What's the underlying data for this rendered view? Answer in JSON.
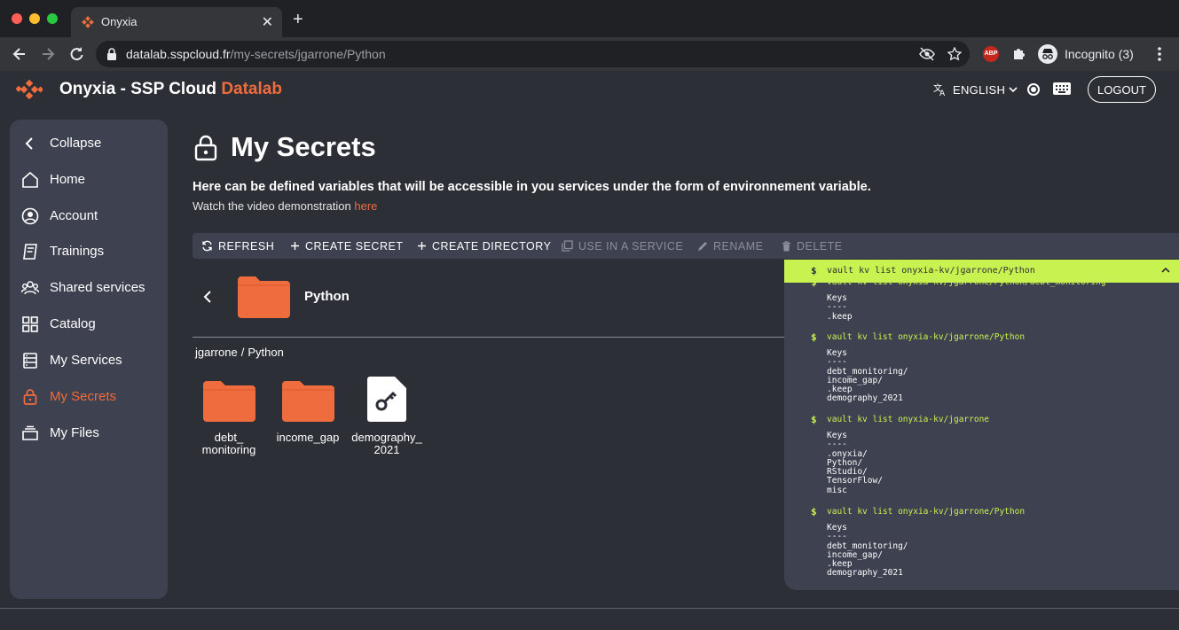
{
  "browser": {
    "tab_title": "Onyxia",
    "url_host": "datalab.sspcloud.fr",
    "url_path": "/my-secrets/jgarrone/Python",
    "profile_label": "Incognito (3)",
    "abp_label": "ABP"
  },
  "header": {
    "title": "Onyxia - SSP Cloud",
    "title_accent": "Datalab",
    "language": "ENGLISH",
    "logout": "LOGOUT"
  },
  "sidebar": {
    "items": [
      {
        "label": "Collapse",
        "icon": "chevron-left-icon"
      },
      {
        "label": "Home",
        "icon": "home-icon"
      },
      {
        "label": "Account",
        "icon": "account-icon"
      },
      {
        "label": "Trainings",
        "icon": "trainings-icon"
      },
      {
        "label": "Shared services",
        "icon": "shared-services-icon"
      },
      {
        "label": "Catalog",
        "icon": "catalog-icon"
      },
      {
        "label": "My Services",
        "icon": "services-icon"
      },
      {
        "label": "My Secrets",
        "icon": "lock-icon",
        "active": true
      },
      {
        "label": "My Files",
        "icon": "files-icon"
      }
    ]
  },
  "page": {
    "title": "My Secrets",
    "subtitle": "Here can be defined variables that will be accessible in you services under the form of environnement variable.",
    "help_prefix": "Watch the video demonstration",
    "help_link": "here"
  },
  "actions": [
    {
      "label": "REFRESH",
      "enabled": true
    },
    {
      "label": "CREATE SECRET",
      "enabled": true
    },
    {
      "label": "CREATE DIRECTORY",
      "enabled": true
    },
    {
      "label": "USE IN A SERVICE",
      "enabled": false
    },
    {
      "label": "RENAME",
      "enabled": false
    },
    {
      "label": "DELETE",
      "enabled": false
    }
  ],
  "directory": {
    "current": "Python",
    "breadcrumb": [
      "jgarrone",
      "Python"
    ],
    "items": [
      {
        "type": "folder",
        "name": "debt_\nmonitoring"
      },
      {
        "type": "folder",
        "name": "income_gap"
      },
      {
        "type": "secret",
        "name": "demography_\n2021"
      }
    ]
  },
  "terminal": {
    "head_command": "vault kv list onyxia-kv/jgarrone/Python",
    "partial_command": "vault kv list onyxia-kv/jgarrone/Python/debt_monitoring",
    "partial_output": "Keys\n----\n.keep",
    "blocks": [
      {
        "command": "vault kv list onyxia-kv/jgarrone/Python",
        "output": "Keys\n----\ndebt_monitoring/\nincome_gap/\n.keep\ndemography_2021"
      },
      {
        "command": "vault kv list onyxia-kv/jgarrone",
        "output": "Keys\n----\n.onyxia/\nPython/\nRStudio/\nTensorFlow/\nmisc"
      },
      {
        "command": "vault kv list onyxia-kv/jgarrone/Python",
        "output": "Keys\n----\ndebt_monitoring/\nincome_gap/\n.keep\ndemography_2021"
      }
    ],
    "prompt": "$"
  },
  "colors": {
    "accent": "#ee6c3d",
    "terminal_accent": "#c8f24f",
    "background": "#2c2f36",
    "panel": "#3e4150"
  }
}
